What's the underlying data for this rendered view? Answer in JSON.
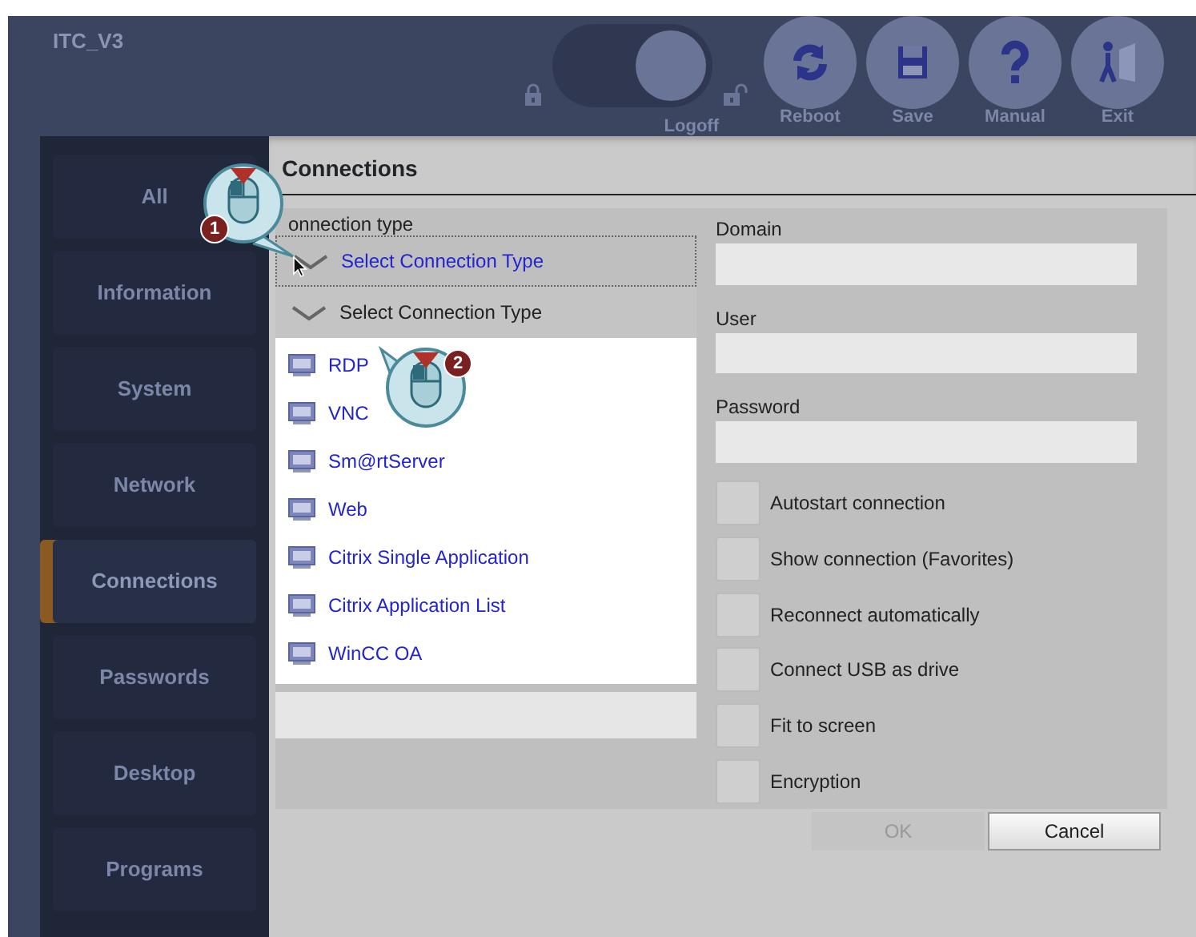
{
  "header": {
    "title": "ITC_V3",
    "toggle": {
      "label": "Logoff",
      "on": true
    },
    "buttons": [
      {
        "kind": "reboot",
        "label": "Reboot"
      },
      {
        "kind": "save",
        "label": "Save"
      },
      {
        "kind": "manual",
        "label": "Manual"
      },
      {
        "kind": "exit",
        "label": "Exit"
      }
    ]
  },
  "sidebar": {
    "items": [
      {
        "label": "All",
        "selected": false
      },
      {
        "label": "Information",
        "selected": false
      },
      {
        "label": "System",
        "selected": false
      },
      {
        "label": "Network",
        "selected": false
      },
      {
        "label": "Connections",
        "selected": true
      },
      {
        "label": "Passwords",
        "selected": false
      },
      {
        "label": "Desktop",
        "selected": false
      },
      {
        "label": "Programs",
        "selected": false
      }
    ]
  },
  "panel": {
    "title": "Connections",
    "connection_type": {
      "label": "onnection type",
      "value": "Select Connection Type",
      "list_header": "Select Connection Type",
      "options": [
        {
          "label": "RDP"
        },
        {
          "label": "VNC"
        },
        {
          "label": "Sm@rtServer"
        },
        {
          "label": "Web"
        },
        {
          "label": "Citrix Single Application"
        },
        {
          "label": "Citrix Application List"
        },
        {
          "label": "WinCC OA"
        }
      ]
    },
    "fields": [
      {
        "label": "Domain"
      },
      {
        "label": "User"
      },
      {
        "label": "Password"
      }
    ],
    "options": [
      {
        "label": "Autostart connection",
        "checked": false
      },
      {
        "label": "Show connection (Favorites)",
        "checked": false
      },
      {
        "label": "Reconnect automatically",
        "checked": false
      },
      {
        "label": "Connect USB as drive",
        "checked": false
      },
      {
        "label": "Fit to screen",
        "checked": false
      },
      {
        "label": "Encryption",
        "checked": false
      }
    ],
    "buttons": [
      {
        "label": "OK",
        "disabled": true
      },
      {
        "label": "Cancel",
        "disabled": false
      }
    ]
  },
  "callouts": [
    {
      "number": "1"
    },
    {
      "number": "2"
    }
  ]
}
